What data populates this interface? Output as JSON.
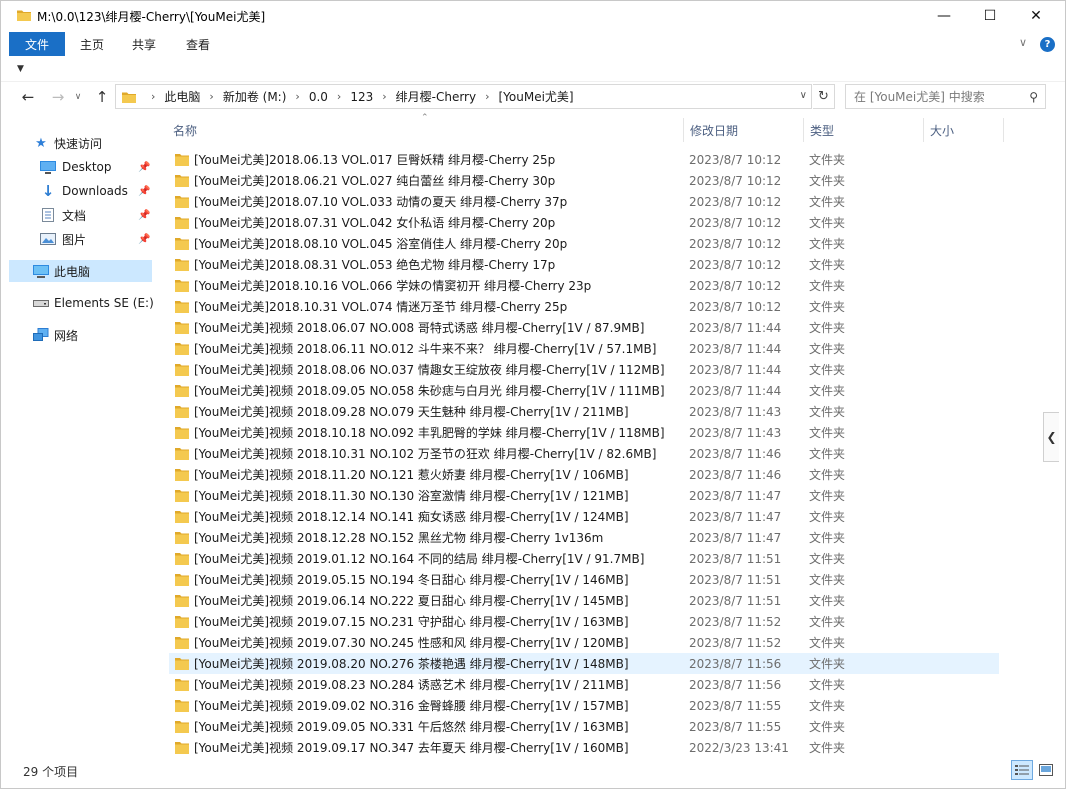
{
  "window": {
    "title": "M:\\0.0\\123\\绯月樱-Cherry\\[YouMei尤美]",
    "controls": {
      "minimize": "—",
      "maximize": "☐",
      "close": "✕"
    }
  },
  "ribbon": {
    "tabs": [
      "文件",
      "主页",
      "共享",
      "查看"
    ],
    "help": "?"
  },
  "address": {
    "crumbs": [
      "此电脑",
      "新加卷 (M:)",
      "0.0",
      "123",
      "绯月樱-Cherry",
      "[YouMei尤美]"
    ]
  },
  "search": {
    "placeholder": "在 [YouMei尤美] 中搜索"
  },
  "navpane": {
    "items": [
      {
        "label": "快速访问",
        "icon": "star-icon"
      },
      {
        "label": "Desktop",
        "icon": "desktop-icon",
        "pinned": true
      },
      {
        "label": "Downloads",
        "icon": "download-icon",
        "pinned": true
      },
      {
        "label": "文档",
        "icon": "document-icon",
        "pinned": true
      },
      {
        "label": "图片",
        "icon": "pictures-icon",
        "pinned": true
      },
      {
        "label": "此电脑",
        "icon": "computer-icon",
        "selected": true
      },
      {
        "label": "Elements SE (E:)",
        "icon": "drive-icon"
      },
      {
        "label": "网络",
        "icon": "network-icon"
      }
    ]
  },
  "columns": {
    "name": "名称",
    "date": "修改日期",
    "type": "类型",
    "size": "大小"
  },
  "files": [
    {
      "name": "[YouMei尤美]2018.06.13 VOL.017 巨臀妖精 绯月樱-Cherry 25p",
      "date": "2023/8/7 10:12",
      "type": "文件夹"
    },
    {
      "name": "[YouMei尤美]2018.06.21 VOL.027 纯白蕾丝 绯月樱-Cherry 30p",
      "date": "2023/8/7 10:12",
      "type": "文件夹"
    },
    {
      "name": "[YouMei尤美]2018.07.10 VOL.033 动情の夏天 绯月樱-Cherry 37p",
      "date": "2023/8/7 10:12",
      "type": "文件夹"
    },
    {
      "name": "[YouMei尤美]2018.07.31 VOL.042 女仆私语 绯月樱-Cherry 20p",
      "date": "2023/8/7 10:12",
      "type": "文件夹"
    },
    {
      "name": "[YouMei尤美]2018.08.10 VOL.045 浴室俏佳人 绯月樱-Cherry 20p",
      "date": "2023/8/7 10:12",
      "type": "文件夹"
    },
    {
      "name": "[YouMei尤美]2018.08.31 VOL.053 绝色尤物 绯月樱-Cherry 17p",
      "date": "2023/8/7 10:12",
      "type": "文件夹"
    },
    {
      "name": "[YouMei尤美]2018.10.16 VOL.066 学妹の情窦初开 绯月樱-Cherry 23p",
      "date": "2023/8/7 10:12",
      "type": "文件夹"
    },
    {
      "name": "[YouMei尤美]2018.10.31 VOL.074 情迷万圣节 绯月樱-Cherry 25p",
      "date": "2023/8/7 10:12",
      "type": "文件夹"
    },
    {
      "name": "[YouMei尤美]视频 2018.06.07 NO.008 哥特式诱惑 绯月樱-Cherry[1V / 87.9MB]",
      "date": "2023/8/7 11:44",
      "type": "文件夹"
    },
    {
      "name": "[YouMei尤美]视频 2018.06.11 NO.012 斗牛来不来？ 绯月樱-Cherry[1V / 57.1MB]",
      "date": "2023/8/7 11:44",
      "type": "文件夹"
    },
    {
      "name": "[YouMei尤美]视频 2018.08.06 NO.037 情趣女王绽放夜 绯月樱-Cherry[1V / 112MB]",
      "date": "2023/8/7 11:44",
      "type": "文件夹"
    },
    {
      "name": "[YouMei尤美]视频 2018.09.05 NO.058 朱砂痣与白月光 绯月樱-Cherry[1V / 111MB]",
      "date": "2023/8/7 11:44",
      "type": "文件夹"
    },
    {
      "name": "[YouMei尤美]视频 2018.09.28 NO.079 天生魅种 绯月樱-Cherry[1V / 211MB]",
      "date": "2023/8/7 11:43",
      "type": "文件夹"
    },
    {
      "name": "[YouMei尤美]视频 2018.10.18 NO.092 丰乳肥臀的学妹 绯月樱-Cherry[1V / 118MB]",
      "date": "2023/8/7 11:43",
      "type": "文件夹"
    },
    {
      "name": "[YouMei尤美]视频 2018.10.31 NO.102  万圣节の狂欢 绯月樱-Cherry[1V / 82.6MB]",
      "date": "2023/8/7 11:46",
      "type": "文件夹"
    },
    {
      "name": "[YouMei尤美]视频 2018.11.20 NO.121 惹火娇妻 绯月樱-Cherry[1V / 106MB]",
      "date": "2023/8/7 11:46",
      "type": "文件夹"
    },
    {
      "name": "[YouMei尤美]视频 2018.11.30 NO.130 浴室激情 绯月樱-Cherry[1V / 121MB]",
      "date": "2023/8/7 11:47",
      "type": "文件夹"
    },
    {
      "name": "[YouMei尤美]视频 2018.12.14 NO.141 痴女诱惑 绯月樱-Cherry[1V / 124MB]",
      "date": "2023/8/7 11:47",
      "type": "文件夹"
    },
    {
      "name": "[YouMei尤美]视频 2018.12.28 NO.152 黑丝尤物 绯月樱-Cherry 1v136m",
      "date": "2023/8/7 11:47",
      "type": "文件夹"
    },
    {
      "name": "[YouMei尤美]视频 2019.01.12 NO.164 不同的结局 绯月樱-Cherry[1V / 91.7MB]",
      "date": "2023/8/7 11:51",
      "type": "文件夹"
    },
    {
      "name": "[YouMei尤美]视频 2019.05.15 NO.194 冬日甜心 绯月樱-Cherry[1V / 146MB]",
      "date": "2023/8/7 11:51",
      "type": "文件夹"
    },
    {
      "name": "[YouMei尤美]视频 2019.06.14 NO.222 夏日甜心 绯月樱-Cherry[1V / 145MB]",
      "date": "2023/8/7 11:51",
      "type": "文件夹"
    },
    {
      "name": "[YouMei尤美]视频 2019.07.15 NO.231 守护甜心 绯月樱-Cherry[1V / 163MB]",
      "date": "2023/8/7 11:52",
      "type": "文件夹"
    },
    {
      "name": "[YouMei尤美]视频 2019.07.30 NO.245 性感和风 绯月樱-Cherry[1V / 120MB]",
      "date": "2023/8/7 11:52",
      "type": "文件夹"
    },
    {
      "name": "[YouMei尤美]视频 2019.08.20 NO.276 茶楼艳遇 绯月樱-Cherry[1V / 148MB]",
      "date": "2023/8/7 11:56",
      "type": "文件夹",
      "hover": true
    },
    {
      "name": "[YouMei尤美]视频 2019.08.23 NO.284 诱惑艺术 绯月樱-Cherry[1V / 211MB]",
      "date": "2023/8/7 11:56",
      "type": "文件夹"
    },
    {
      "name": "[YouMei尤美]视频 2019.09.02 NO.316 金臀蜂腰 绯月樱-Cherry[1V / 157MB]",
      "date": "2023/8/7 11:55",
      "type": "文件夹"
    },
    {
      "name": "[YouMei尤美]视频 2019.09.05 NO.331 午后悠然 绯月樱-Cherry[1V / 163MB]",
      "date": "2023/8/7 11:55",
      "type": "文件夹"
    },
    {
      "name": "[YouMei尤美]视频 2019.09.17 NO.347 去年夏天 绯月樱-Cherry[1V / 160MB]",
      "date": "2022/3/23 13:41",
      "type": "文件夹"
    }
  ],
  "status": {
    "count": "29 个项目"
  },
  "colors": {
    "accent": "#1a6fc6",
    "folder": "#f4c94f",
    "folder_dark": "#e0a92a",
    "selection": "#cce8ff",
    "hover": "#e5f3ff",
    "header_text": "#4d6082"
  }
}
